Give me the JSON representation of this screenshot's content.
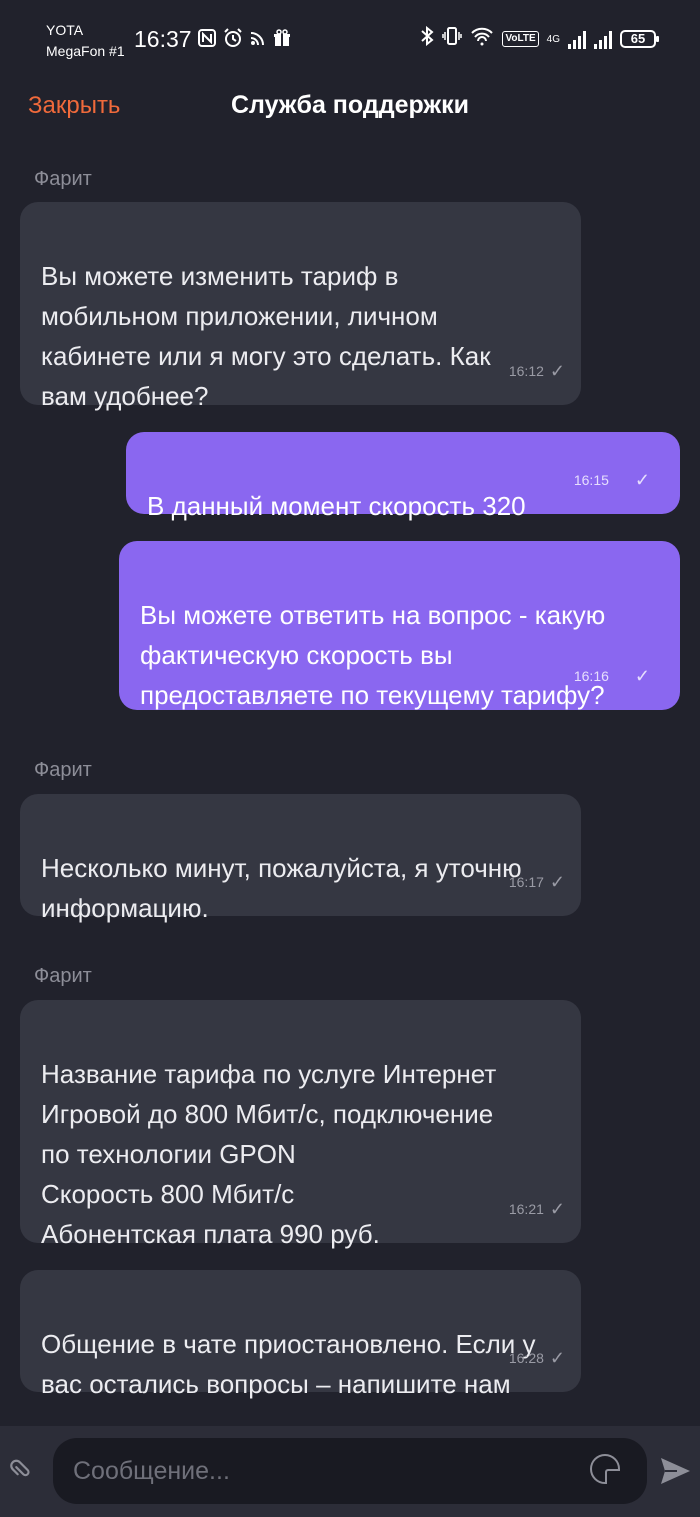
{
  "status_bar": {
    "carrier_line1": "YOTA",
    "carrier_line2": "MegaFon #1",
    "time": "16:37",
    "volte_label": "VoLTE",
    "network_label": "4G",
    "battery": "65"
  },
  "header": {
    "close_label": "Закрыть",
    "title": "Служба поддержки"
  },
  "messages": [
    {
      "direction": "in",
      "sender": "Фарит",
      "text": "Вы можете изменить тариф в\nмобильном приложении, личном\nкабинете или я могу это сделать. Как\nвам удобнее?",
      "time": "16:12"
    },
    {
      "direction": "out",
      "text": "В данный момент скорость 320",
      "time": "16:15"
    },
    {
      "direction": "out",
      "text": "Вы можете ответить на вопрос - какую\nфактическую скорость вы\nпредоставляете по текущему тарифу?",
      "time": "16:16"
    },
    {
      "direction": "in",
      "sender": "Фарит",
      "text": "Несколько минут, пожалуйста, я уточню\nинформацию.",
      "time": "16:17"
    },
    {
      "direction": "in",
      "sender": "Фарит",
      "text": "Название тарифа по услуге Интернет\nИгровой до 800 Мбит/с, подключение\nпо технологии GPON\nСкорость 800 Мбит/с\nАбонентская плата 990 руб.",
      "time": "16:21"
    },
    {
      "direction": "in",
      "text": "Общение в чате приостановлено. Если у\nвас остались вопросы – напишите нам",
      "time": "16:28"
    }
  ],
  "composer": {
    "placeholder": "Сообщение..."
  },
  "colors": {
    "background": "#21222c",
    "incoming_bubble": "#353742",
    "outgoing_bubble": "#8a67f0",
    "accent": "#f06a3b"
  }
}
